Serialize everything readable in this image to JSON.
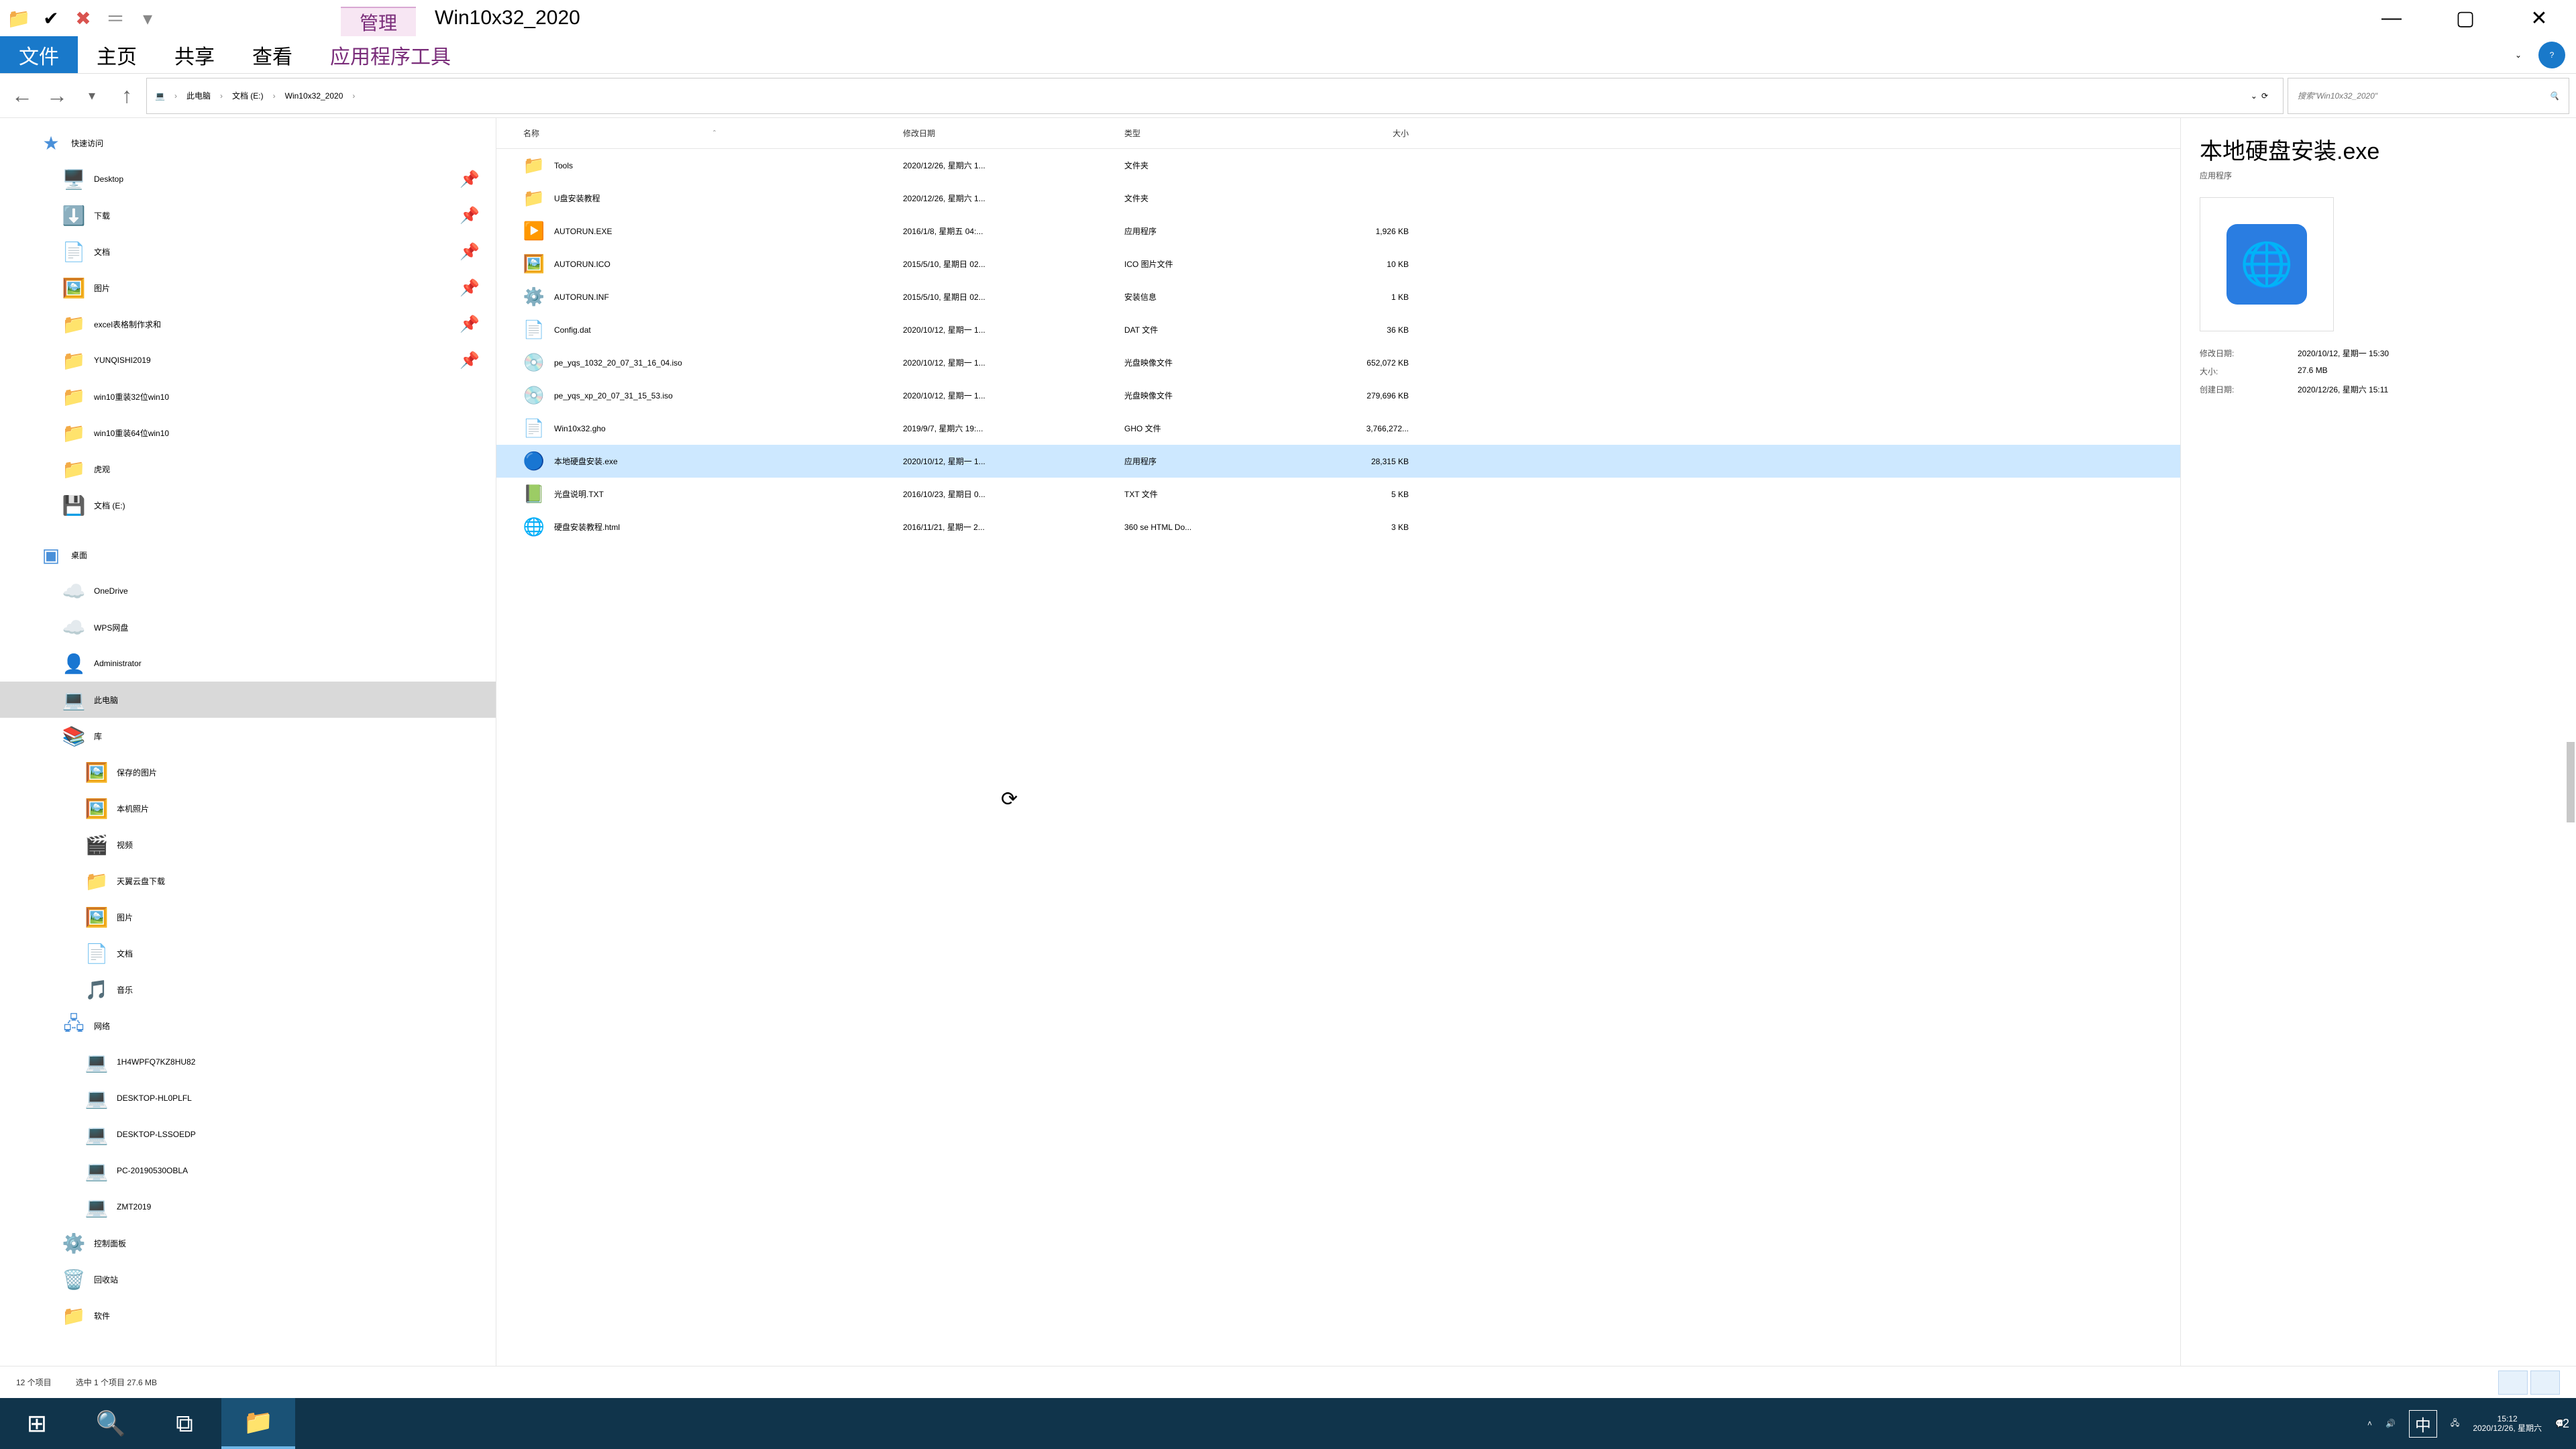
{
  "window": {
    "manage_tab": "管理",
    "title": "Win10x32_2020",
    "min": "—",
    "max": "▢",
    "close": "✕"
  },
  "ribbon": {
    "file": "文件",
    "home": "主页",
    "share": "共享",
    "view": "查看",
    "apptools": "应用程序工具"
  },
  "nav": {
    "back": "←",
    "fwd": "→",
    "up": "↑",
    "refresh": "⟳",
    "dropdown": "⌄"
  },
  "breadcrumb": {
    "root_icon": "💻",
    "parts": [
      "此电脑",
      "文档 (E:)",
      "Win10x32_2020"
    ]
  },
  "search": {
    "placeholder": "搜索\"Win10x32_2020\"",
    "icon": "🔍"
  },
  "tree": {
    "quick": "快速访问",
    "quick_items": [
      {
        "icon": "🖥️",
        "label": "Desktop",
        "pin": true
      },
      {
        "icon": "⬇️",
        "label": "下载",
        "pin": true
      },
      {
        "icon": "📄",
        "label": "文档",
        "pin": true
      },
      {
        "icon": "🖼️",
        "label": "图片",
        "pin": true
      },
      {
        "icon": "📁",
        "label": "excel表格制作求和",
        "pin": true
      },
      {
        "icon": "📁",
        "label": "YUNQISHI2019",
        "pin": true
      },
      {
        "icon": "📁",
        "label": "win10重装32位win10"
      },
      {
        "icon": "📁",
        "label": "win10重装64位win10"
      },
      {
        "icon": "📁",
        "label": "虎观"
      },
      {
        "icon": "💾",
        "label": "文档 (E:)"
      }
    ],
    "desktop": "桌面",
    "desktop_items": [
      {
        "icon": "☁️",
        "label": "OneDrive"
      },
      {
        "icon": "☁️",
        "label": "WPS网盘"
      },
      {
        "icon": "👤",
        "label": "Administrator"
      },
      {
        "icon": "💻",
        "label": "此电脑",
        "sel": true
      },
      {
        "icon": "📚",
        "label": "库"
      }
    ],
    "lib_items": [
      {
        "icon": "🖼️",
        "label": "保存的图片"
      },
      {
        "icon": "🖼️",
        "label": "本机照片"
      },
      {
        "icon": "🎬",
        "label": "视频"
      },
      {
        "icon": "📁",
        "label": "天翼云盘下载"
      },
      {
        "icon": "🖼️",
        "label": "图片"
      },
      {
        "icon": "📄",
        "label": "文档"
      },
      {
        "icon": "🎵",
        "label": "音乐"
      }
    ],
    "network": "网络",
    "net_items": [
      {
        "icon": "💻",
        "label": "1H4WPFQ7KZ8HU82"
      },
      {
        "icon": "💻",
        "label": "DESKTOP-HL0PLFL"
      },
      {
        "icon": "💻",
        "label": "DESKTOP-LSSOEDP"
      },
      {
        "icon": "💻",
        "label": "PC-20190530OBLA"
      },
      {
        "icon": "💻",
        "label": "ZMT2019"
      }
    ],
    "extras": [
      {
        "icon": "⚙️",
        "label": "控制面板"
      },
      {
        "icon": "🗑️",
        "label": "回收站"
      },
      {
        "icon": "📁",
        "label": "软件"
      }
    ]
  },
  "columns": {
    "name": "名称",
    "date": "修改日期",
    "type": "类型",
    "size": "大小",
    "sort": "ˆ"
  },
  "files": [
    {
      "icon": "📁",
      "name": "Tools",
      "date": "2020/12/26, 星期六 1...",
      "type": "文件夹",
      "size": ""
    },
    {
      "icon": "📁",
      "name": "U盘安装教程",
      "date": "2020/12/26, 星期六 1...",
      "type": "文件夹",
      "size": ""
    },
    {
      "icon": "▶️",
      "name": "AUTORUN.EXE",
      "date": "2016/1/8, 星期五 04:...",
      "type": "应用程序",
      "size": "1,926 KB"
    },
    {
      "icon": "🖼️",
      "name": "AUTORUN.ICO",
      "date": "2015/5/10, 星期日 02...",
      "type": "ICO 图片文件",
      "size": "10 KB"
    },
    {
      "icon": "⚙️",
      "name": "AUTORUN.INF",
      "date": "2015/5/10, 星期日 02...",
      "type": "安装信息",
      "size": "1 KB"
    },
    {
      "icon": "📄",
      "name": "Config.dat",
      "date": "2020/10/12, 星期一 1...",
      "type": "DAT 文件",
      "size": "36 KB"
    },
    {
      "icon": "💿",
      "name": "pe_yqs_1032_20_07_31_16_04.iso",
      "date": "2020/10/12, 星期一 1...",
      "type": "光盘映像文件",
      "size": "652,072 KB"
    },
    {
      "icon": "💿",
      "name": "pe_yqs_xp_20_07_31_15_53.iso",
      "date": "2020/10/12, 星期一 1...",
      "type": "光盘映像文件",
      "size": "279,696 KB"
    },
    {
      "icon": "📄",
      "name": "Win10x32.gho",
      "date": "2019/9/7, 星期六 19:...",
      "type": "GHO 文件",
      "size": "3,766,272..."
    },
    {
      "icon": "🔵",
      "name": "本地硬盘安装.exe",
      "date": "2020/10/12, 星期一 1...",
      "type": "应用程序",
      "size": "28,315 KB",
      "sel": true
    },
    {
      "icon": "📗",
      "name": "光盘说明.TXT",
      "date": "2016/10/23, 星期日 0...",
      "type": "TXT 文件",
      "size": "5 KB"
    },
    {
      "icon": "🌐",
      "name": "硬盘安装教程.html",
      "date": "2016/11/21, 星期一 2...",
      "type": "360 se HTML Do...",
      "size": "3 KB"
    }
  ],
  "details": {
    "title": "本地硬盘安装.exe",
    "subtitle": "应用程序",
    "rows": [
      {
        "k": "修改日期:",
        "v": "2020/10/12, 星期一 15:30"
      },
      {
        "k": "大小:",
        "v": "27.6 MB"
      },
      {
        "k": "创建日期:",
        "v": "2020/12/26, 星期六 15:11"
      }
    ]
  },
  "status": {
    "count": "12 个项目",
    "selection": "选中 1 个项目  27.6 MB"
  },
  "taskbar": {
    "start": "⊞",
    "search": "🔍",
    "taskview": "⧉",
    "explorer": "📁",
    "tray_up": "˄",
    "vol": "🔊",
    "ime": "中",
    "net": "🖧",
    "time": "15:12",
    "date": "2020/12/26, 星期六",
    "action": "💬",
    "badge": "2"
  }
}
